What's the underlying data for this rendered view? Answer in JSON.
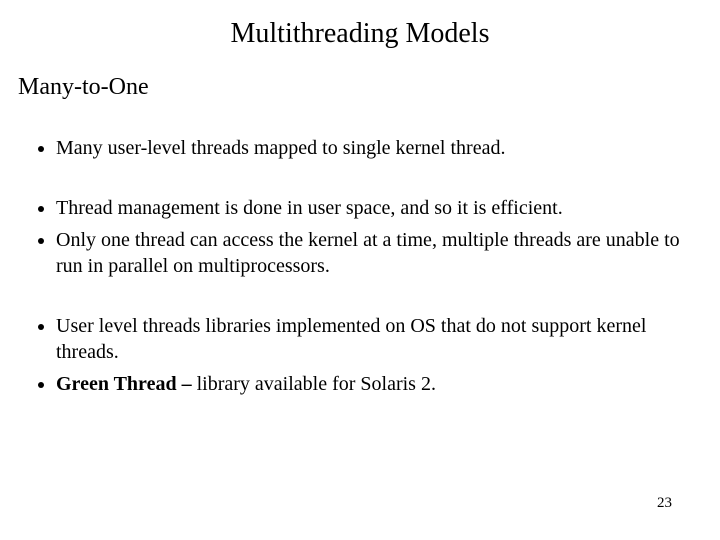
{
  "title": "Multithreading Models",
  "subtitle": "Many-to-One",
  "groups": [
    {
      "items": [
        {
          "text": "Many user-level threads mapped to single kernel thread."
        }
      ]
    },
    {
      "items": [
        {
          "text": "Thread management is done in user space, and so it is efficient."
        },
        {
          "text": "Only one thread can access the kernel at a time, multiple threads are unable to run in parallel on multiprocessors."
        }
      ]
    },
    {
      "items": [
        {
          "text": "User level threads libraries implemented on OS that do not support kernel threads."
        },
        {
          "bold_lead": "Green Thread – ",
          "text": "library available for Solaris 2."
        }
      ]
    }
  ],
  "page_number": "23"
}
